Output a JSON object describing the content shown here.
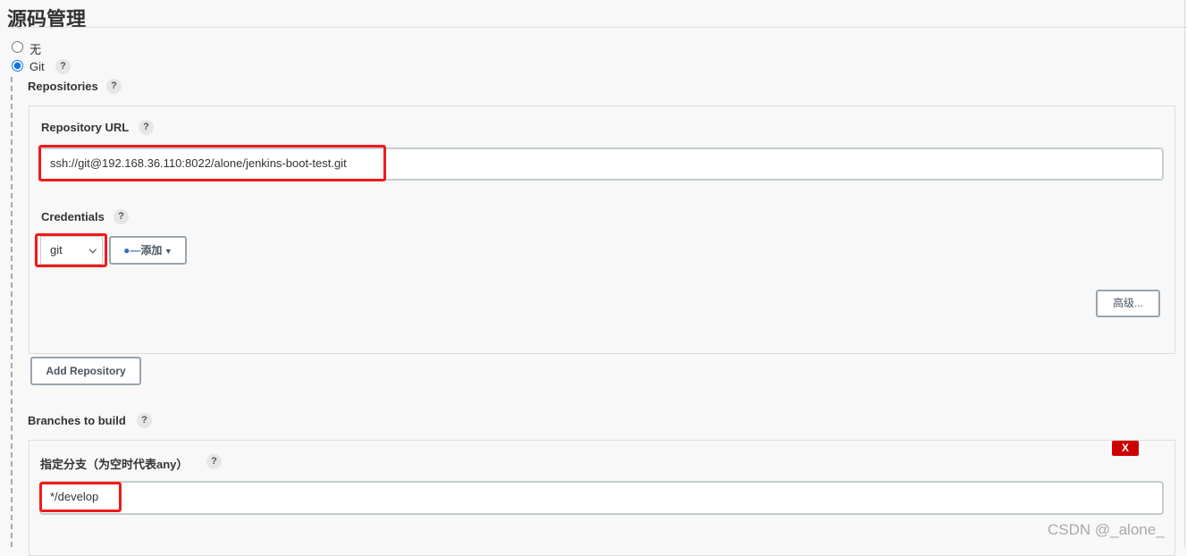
{
  "section_title": "源码管理",
  "scm_options": [
    {
      "label": "无",
      "selected": false
    },
    {
      "label": "Git",
      "selected": true
    }
  ],
  "help": "?",
  "repositories": {
    "label": "Repositories",
    "url_label": "Repository URL",
    "url_value": "ssh://git@192.168.36.110:8022/alone/jenkins-boot-test.git",
    "credentials_label": "Credentials",
    "credentials_selected": "git",
    "add_button": "添加",
    "advanced_button": "高级...",
    "add_repository_button": "Add Repository"
  },
  "branches": {
    "label": "Branches to build",
    "branch_label": "指定分支（为空时代表any）",
    "branch_value": "*/develop",
    "delete_button": "X"
  },
  "watermark": "CSDN @_alone_",
  "colors": {
    "highlight": "#f01b1b",
    "delete": "#cc0000",
    "radio": "#0b76e0"
  }
}
